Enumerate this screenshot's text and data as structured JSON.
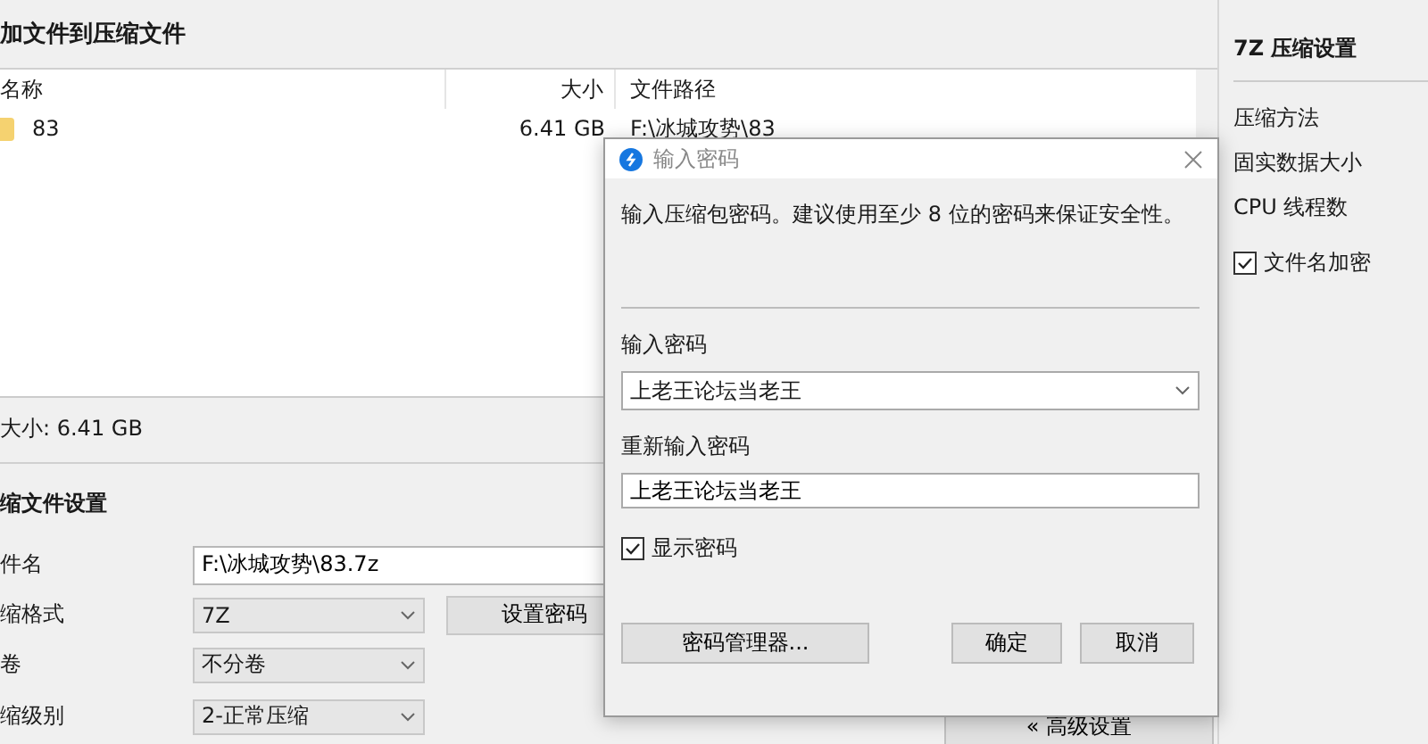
{
  "main_window": {
    "title": "加文件到压缩文件",
    "file_list": {
      "columns": [
        "名称",
        "大小",
        "文件路径"
      ],
      "rows": [
        {
          "name": "83",
          "size": "6.41 GB",
          "path": "F:\\冰城攻势\\83"
        }
      ]
    },
    "total_size": "大小: 6.41 GB",
    "settings": {
      "heading": "缩文件设置",
      "fields": [
        {
          "kind": "text",
          "label": "件名",
          "value": "F:\\冰城攻势\\83.7z"
        },
        {
          "kind": "select",
          "label": "缩格式",
          "value": "7Z",
          "button": "设置密码"
        },
        {
          "kind": "select",
          "label": "卷",
          "value": "不分卷"
        },
        {
          "kind": "select",
          "label": "缩级别",
          "value": "2-正常压缩",
          "button": "« 高级设置"
        }
      ]
    }
  },
  "side_panel": {
    "title": "7Z 压缩设置",
    "items": [
      {
        "kind": "label",
        "label": "压缩方法"
      },
      {
        "kind": "label",
        "label": "固实数据大小"
      },
      {
        "kind": "label",
        "label": "CPU 线程数"
      },
      {
        "kind": "checkbox",
        "label": "文件名加密",
        "checked": true
      }
    ]
  },
  "password_dialog": {
    "title": "输入密码",
    "message": "输入压缩包密码。建议使用至少 8 位的密码来保证安全性。",
    "password_label": "输入密码",
    "password": "上老王论坛当老王",
    "confirm_label": "重新输入密码",
    "confirm": "上老王论坛当老王",
    "show_password": {
      "label": "显示密码",
      "checked": true
    },
    "buttons": [
      {
        "kind": "manager",
        "label": "密码管理器..."
      },
      {
        "kind": "ok",
        "label": "确定"
      },
      {
        "kind": "cancel",
        "label": "取消"
      }
    ]
  }
}
